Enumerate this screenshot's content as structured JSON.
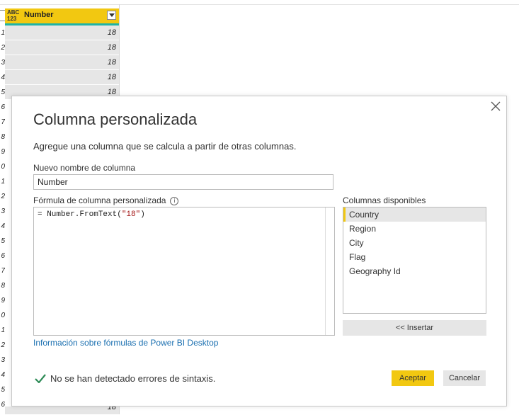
{
  "grid": {
    "type_icon_top": "ABC",
    "type_icon_bottom": "123",
    "column_name": "Number",
    "row_numbers": [
      "1",
      "2",
      "3",
      "4",
      "5",
      "6",
      "7",
      "8",
      "9",
      "0",
      "1",
      "2",
      "3",
      "4",
      "5",
      "6",
      "7",
      "8",
      "9",
      "0",
      "1",
      "2",
      "3",
      "4",
      "5",
      "6"
    ],
    "visible_values": [
      "18",
      "18",
      "18",
      "18",
      "18"
    ],
    "bottom_partial_value": "18"
  },
  "dialog": {
    "title": "Columna personalizada",
    "description": "Agregue una columna que se calcula a partir de otras columnas.",
    "name_label": "Nuevo nombre de columna",
    "name_value": "Number",
    "formula_label": "Fórmula de columna personalizada",
    "info_icon": "i",
    "formula_prefix": "= Number.FromText(",
    "formula_string": "\"18\"",
    "formula_suffix": ")",
    "link_text": "Información sobre fórmulas de Power BI Desktop",
    "columns_label": "Columnas disponibles",
    "columns": [
      "Country",
      "Region",
      "City",
      "Flag",
      "Geography Id"
    ],
    "selected_column": "Country",
    "insert_label": "<< Insertar",
    "status_text": "No se han detectado errores de sintaxis.",
    "ok_label": "Aceptar",
    "cancel_label": "Cancelar"
  },
  "colors": {
    "accent_yellow": "#f2c811",
    "header_underline": "#1fb3a6",
    "link_blue": "#1a6fb0",
    "check_green": "#2e8b57"
  },
  "icons": {
    "close": "close-icon",
    "dropdown": "chevron-down-icon",
    "info": "info-icon",
    "check": "check-icon",
    "type": "type-any-icon"
  }
}
